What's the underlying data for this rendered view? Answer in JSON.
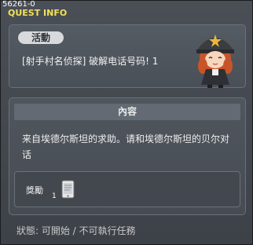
{
  "window": {
    "quest_id": "56261-0",
    "title": "QUEST INFO"
  },
  "quest": {
    "category": "活動",
    "name": "[射手村名侦探] 破解电话号码! 1"
  },
  "content": {
    "header": "內容",
    "text": "来自埃德尔斯坦的求助。请和埃德尔斯坦的贝尔对话"
  },
  "reward": {
    "label": "獎勵",
    "item_icon": "tablet-item-icon",
    "item_count": "1"
  },
  "status": {
    "text": "狀態: 可開始 / 不可執行任務"
  },
  "colors": {
    "title": "#f1e15a",
    "panel_border": "#6a7079"
  }
}
